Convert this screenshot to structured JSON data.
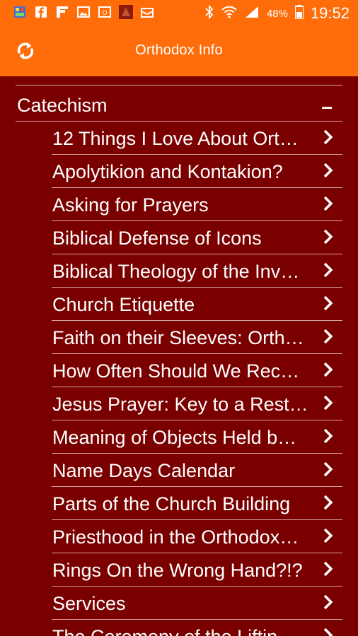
{
  "status_bar": {
    "battery_percent": "48%",
    "time": "19:52",
    "icons": [
      "app-icon",
      "facebook-icon",
      "flipboard-icon",
      "gallery-icon",
      "office-icon",
      "app-icon-2",
      "mail-icon",
      "bluetooth-icon",
      "wifi-icon",
      "signal-icon",
      "battery-icon"
    ]
  },
  "app_bar": {
    "title": "Orthodox Info",
    "refresh_icon": "refresh-icon"
  },
  "section": {
    "label": "Catechism",
    "collapse_symbol": "–"
  },
  "items": [
    {
      "label": "12 Things I Love About Ort…"
    },
    {
      "label": "Apolytikion and Kontakion?"
    },
    {
      "label": "Asking for Prayers"
    },
    {
      "label": "Biblical Defense of Icons"
    },
    {
      "label": "Biblical Theology of the Inv…"
    },
    {
      "label": "Church Etiquette"
    },
    {
      "label": "Faith on their Sleeves: Orth…"
    },
    {
      "label": "How Often Should We Rec…"
    },
    {
      "label": "Jesus Prayer: Key to a Rest…"
    },
    {
      "label": "Meaning of Objects Held b…"
    },
    {
      "label": "Name Days Calendar"
    },
    {
      "label": "Parts of the Church Building"
    },
    {
      "label": "Priesthood in the Orthodox…"
    },
    {
      "label": "Rings On the Wrong Hand?!?"
    },
    {
      "label": "Services"
    },
    {
      "label": "The Ceremony of the Liftin…"
    }
  ],
  "colors": {
    "app_bar": "#ff6d0a",
    "background": "#7a0000",
    "divider": "#d7a4a4",
    "text": "#ffffff"
  }
}
